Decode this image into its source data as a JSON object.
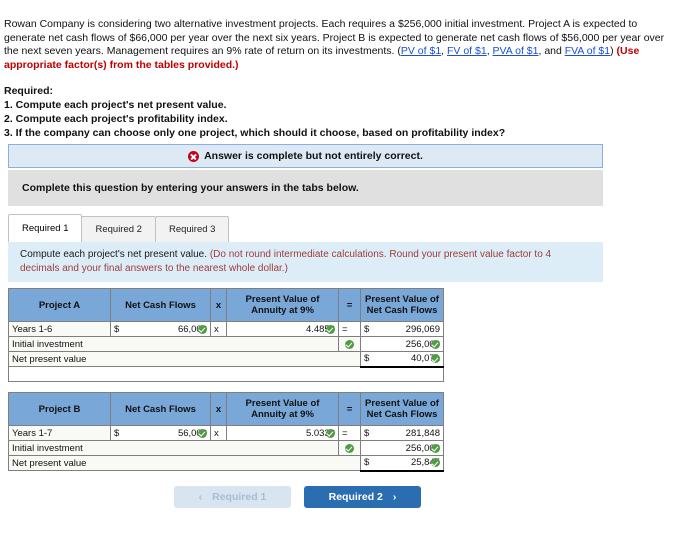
{
  "problem": {
    "part1": "Rowan Company is considering two alternative investment projects. Each requires a $256,000 initial investment. Project A is expected to generate net cash flows of $66,000 per year over the next six years. Project B is expected to generate net cash flows of $56,000 per year over the next seven years. Management requires an 9% rate of return on its investments. (",
    "link_pv": "PV of $1",
    "sep1": ", ",
    "link_fv": "FV of $1",
    "sep2": ", ",
    "link_pva": "PVA of $1",
    "sep3": ", and ",
    "link_fva": "FVA of $1",
    "closeparen": ") ",
    "bold_note": "(Use appropriate factor(s) from the tables provided.)"
  },
  "required": {
    "heading": "Required:",
    "items": [
      "1. Compute each project's net present value.",
      "2. Compute each project's profitability index.",
      "3. If the company can choose only one project, which should it choose, based on profitability index?"
    ]
  },
  "alert": {
    "icon": "error-circle-icon",
    "text": "Answer is complete but not entirely correct."
  },
  "instruction_band": {
    "text": "Complete this question by entering your answers in the tabs below."
  },
  "tabs": [
    {
      "label": "Required 1",
      "active": true
    },
    {
      "label": "Required 2",
      "active": false
    },
    {
      "label": "Required 3",
      "active": false
    }
  ],
  "blue_box": {
    "prompt": "Compute each project's net present value.",
    "hint": "(Do not round intermediate calculations. Round your present value factor to 4 decimals and your final answers to the nearest whole dollar.)"
  },
  "tables": [
    {
      "id": "project-a",
      "headers": {
        "project": "Project A",
        "net_cash_flows": "Net Cash Flows",
        "times": "x",
        "pv_annuity": "Present Value of Annuity at 9%",
        "equals": "=",
        "pv_net_cash_flows": "Present Value of Net Cash Flows"
      },
      "rows": [
        {
          "label": "Years 1-6",
          "cash_dollar": "$",
          "cash_value": "66,000",
          "cash_checked": true,
          "times": "x",
          "factor": "4.4859",
          "factor_checked": true,
          "equals": "=",
          "result_dollar": "$",
          "result_value": "296,069",
          "result_checked": false
        }
      ],
      "initial_investment": {
        "label": "Initial investment",
        "row_checked": true,
        "value": "256,000",
        "value_checked": true
      },
      "npv": {
        "label": "Net present value",
        "dollar": "$",
        "value": "40,071",
        "value_checked": true
      }
    },
    {
      "id": "project-b",
      "headers": {
        "project": "Project B",
        "net_cash_flows": "Net Cash Flows",
        "times": "x",
        "pv_annuity": "Present Value of Annuity at 9%",
        "equals": "=",
        "pv_net_cash_flows": "Present Value of Net Cash Flows"
      },
      "rows": [
        {
          "label": "Years 1-7",
          "cash_dollar": "$",
          "cash_value": "56,000",
          "cash_checked": true,
          "times": "x",
          "factor": "5.0330",
          "factor_checked": true,
          "equals": "=",
          "result_dollar": "$",
          "result_value": "281,848",
          "result_checked": false
        }
      ],
      "initial_investment": {
        "label": "Initial investment",
        "row_checked": true,
        "value": "256,000",
        "value_checked": true
      },
      "npv": {
        "label": "Net present value",
        "dollar": "$",
        "value": "25,845",
        "value_checked": true
      }
    }
  ],
  "nav": {
    "prev_label": "Required 1",
    "prev_arrow": "‹",
    "next_label": "Required 2",
    "next_arrow": "›"
  },
  "colors": {
    "table_header_blue": "#79a7d8",
    "alert_bg": "#ddeaf6",
    "alert_border": "#8ab2d8",
    "blue_box_bg": "#ddedf7",
    "gray_band": "#e0e0e0",
    "check_green": "#4f9c44",
    "error_red": "#c4001a",
    "link_blue": "#1a4fd6",
    "note_red": "#c00000",
    "btn_primary": "#2a6db0",
    "btn_disabled": "#d9e4f1"
  }
}
